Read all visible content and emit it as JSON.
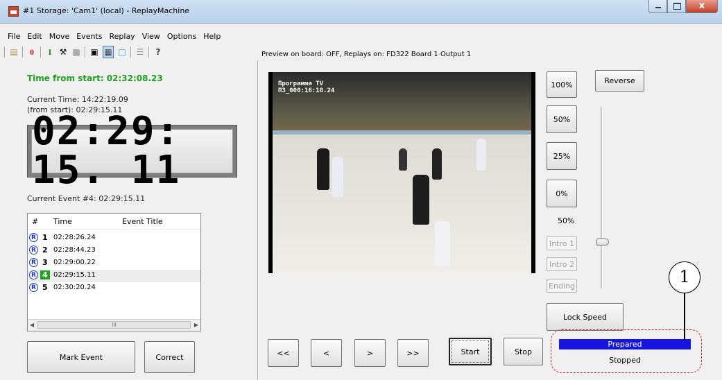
{
  "window": {
    "title": "#1 Storage: 'Cam1' (local) - ReplayMachine"
  },
  "menu": [
    "File",
    "Edit",
    "Move",
    "Events",
    "Replay",
    "View",
    "Options",
    "Help"
  ],
  "toolbar": {
    "icons": [
      "open-folder-icon",
      "zero-icon",
      "cursor-i-icon",
      "tools-icon",
      "camera-icon",
      "video-clip-icon",
      "film-strip-icon",
      "monitor-icon",
      "list-icon",
      "help-icon"
    ]
  },
  "preview_status": "Preview on board: OFF, Replays on: FD322 Board 1 Output 1",
  "left": {
    "time_from_start": "Time from start: 02:32:08.23",
    "current_time": "Current Time: 14:22:19.09",
    "current_time_from_start": "(from start): 02:29:15.11",
    "lcd": "02:29: 15. 11",
    "current_event": "Current Event #4: 02:29:15.11"
  },
  "events": {
    "columns": [
      "#",
      "Time",
      "Event Title"
    ],
    "rows": [
      {
        "num": "1",
        "time": "02:28:26.24"
      },
      {
        "num": "2",
        "time": "02:28:44.23"
      },
      {
        "num": "3",
        "time": "02:29:00.22"
      },
      {
        "num": "4",
        "time": "02:29:15.11"
      },
      {
        "num": "5",
        "time": "02:30:20.24"
      }
    ],
    "scroll_thumb": "III"
  },
  "buttons": {
    "mark_event": "Mark Event",
    "correct": "Correct",
    "speed_100": "100%",
    "speed_50": "50%",
    "speed_25": "25%",
    "speed_0": "0%",
    "reverse": "Reverse",
    "intro1": "Intro 1",
    "intro2": "Intro 2",
    "ending": "Ending",
    "lock_speed": "Lock Speed",
    "rewind_fast": "<<",
    "rewind": "<",
    "forward": ">",
    "forward_fast": ">>",
    "start": "Start",
    "stop": "Stop"
  },
  "speed_value": "50%",
  "video": {
    "overlay_line1": "Программа TV",
    "overlay_line2": "ПЗ_000:16:18.24"
  },
  "status": {
    "prepared": "Prepared",
    "stopped": "Stopped"
  },
  "callout": "1",
  "colors": {
    "time_green": "#1f9e1f",
    "prepared_bg": "#1515dd",
    "callout_dash": "#d0202a",
    "event_highlight": "#21a121"
  }
}
